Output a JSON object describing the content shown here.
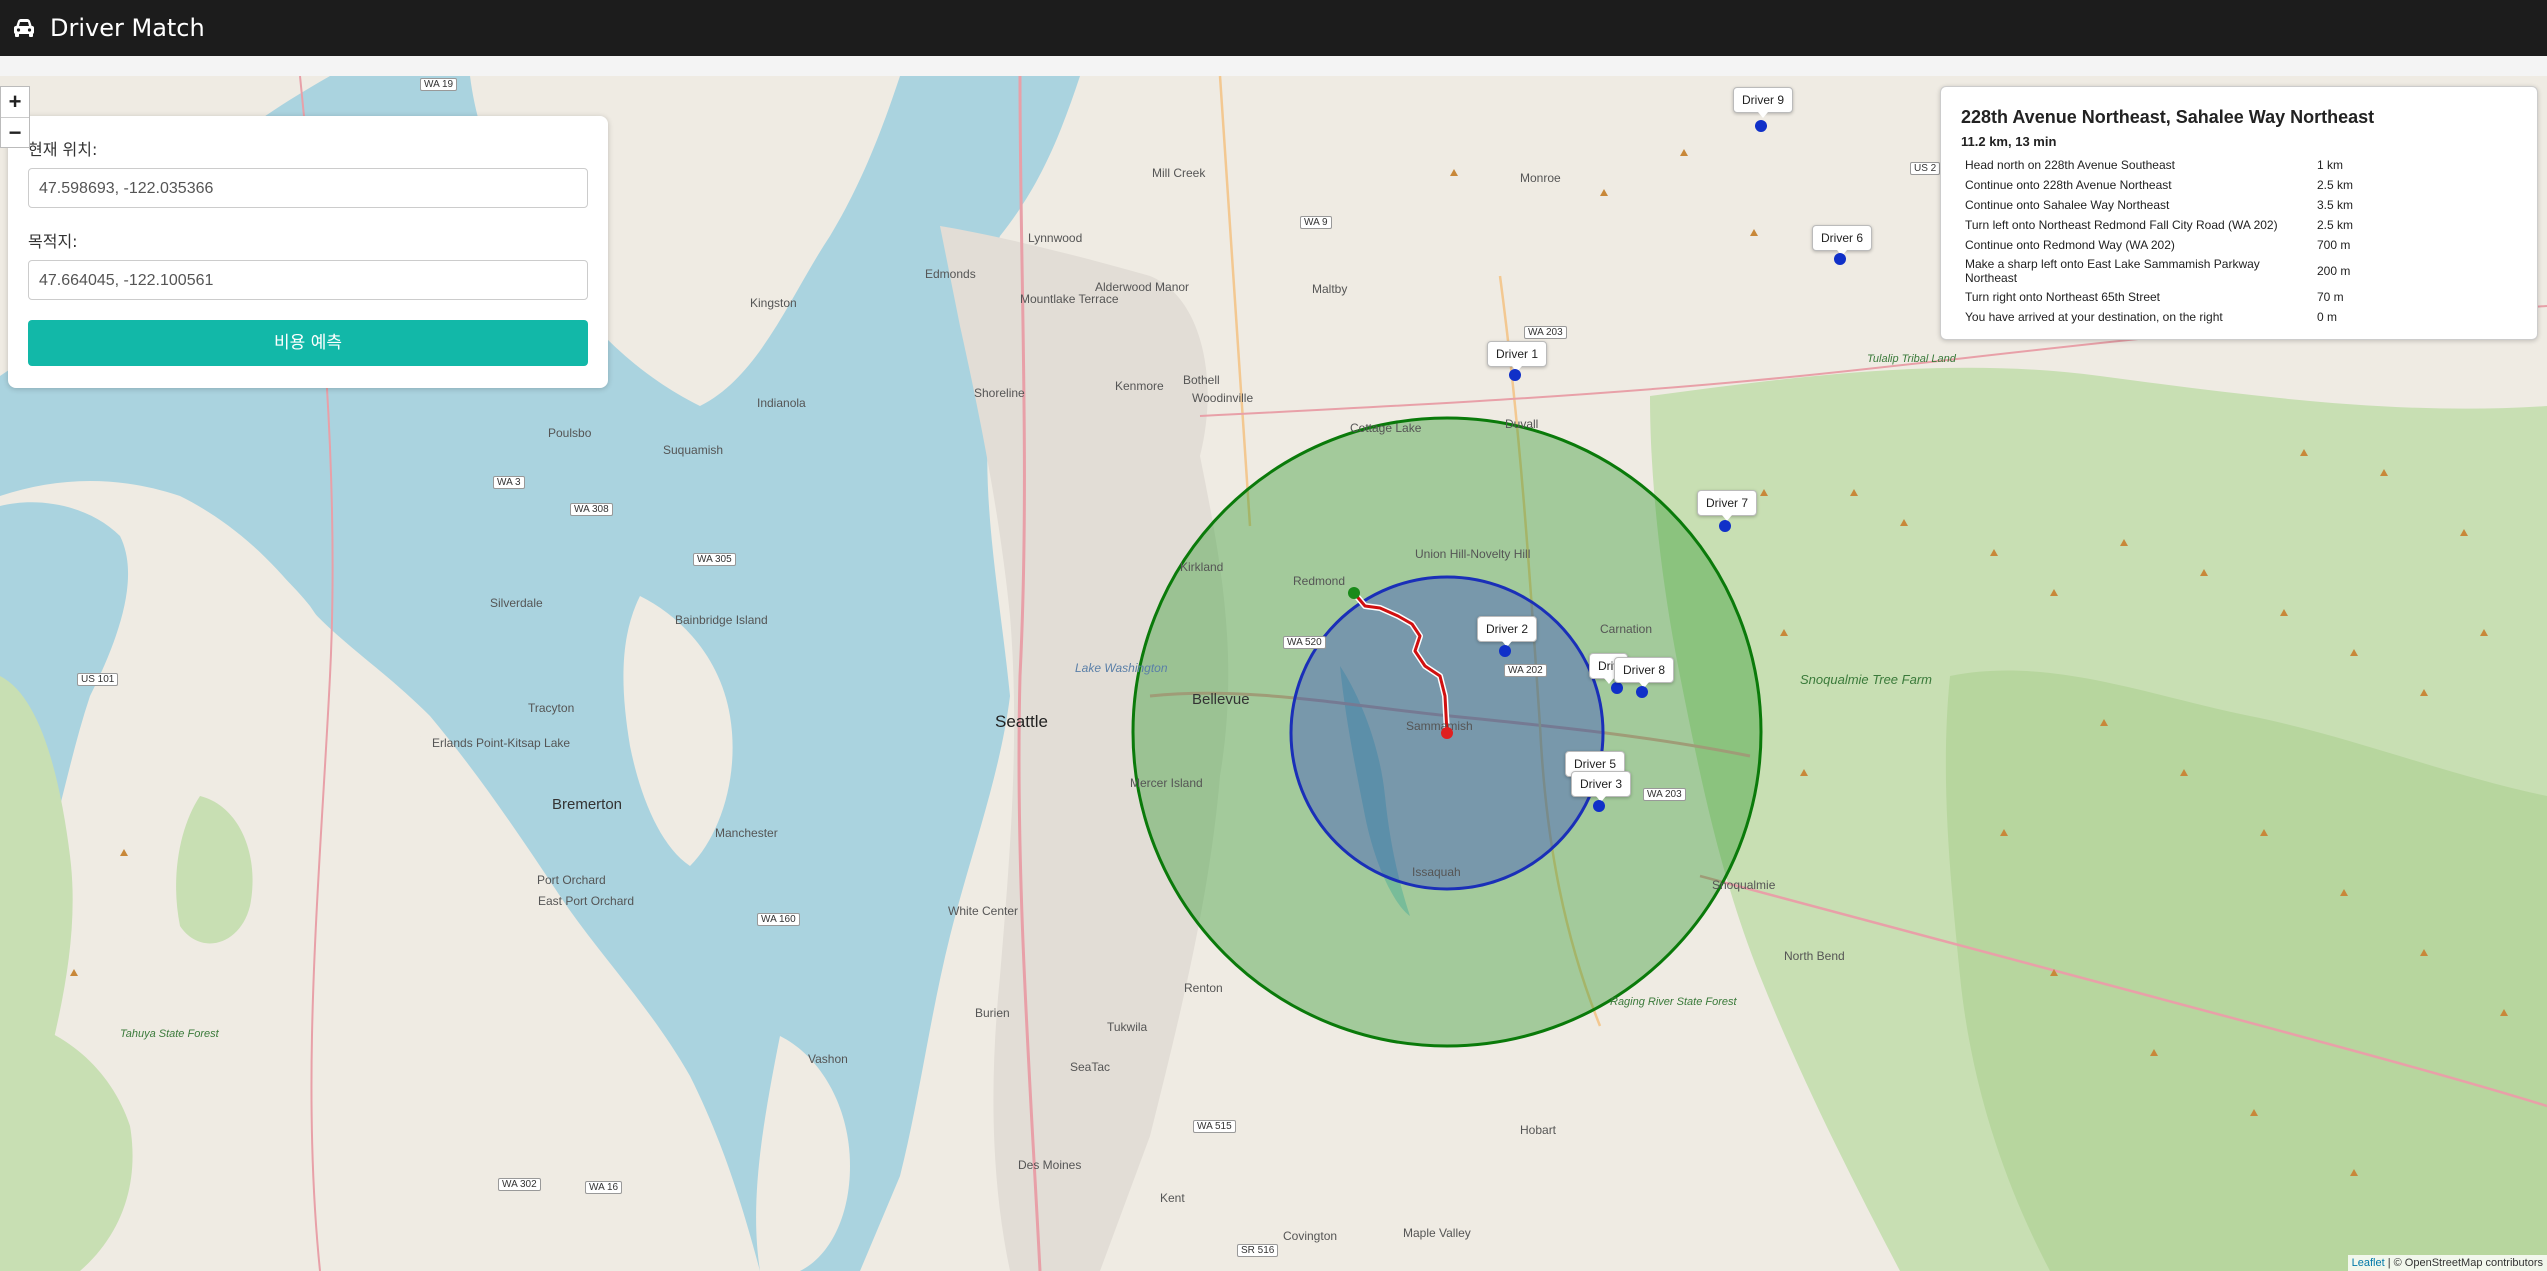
{
  "header": {
    "title": "Driver Match",
    "icon": "car-icon"
  },
  "zoom": {
    "in_label": "+",
    "out_label": "−"
  },
  "form": {
    "current_label": "현재 위치:",
    "current_value": "47.598693, -122.035366",
    "destination_label": "목적지:",
    "destination_value": "47.664045, -122.100561",
    "predict_button": "비용 예측"
  },
  "route": {
    "title": "228th Avenue Northeast, Sahalee Way Northeast",
    "summary": "11.2 km, 13 min",
    "steps": [
      {
        "instruction": "Head north on 228th Avenue Southeast",
        "distance": "1 km"
      },
      {
        "instruction": "Continue onto 228th Avenue Northeast",
        "distance": "2.5 km"
      },
      {
        "instruction": "Continue onto Sahalee Way Northeast",
        "distance": "3.5 km"
      },
      {
        "instruction": "Turn left onto Northeast Redmond Fall City Road (WA 202)",
        "distance": "2.5 km"
      },
      {
        "instruction": "Continue onto Redmond Way (WA 202)",
        "distance": "700 m"
      },
      {
        "instruction": "Make a sharp left onto East Lake Sammamish Parkway Northeast",
        "distance": "200 m"
      },
      {
        "instruction": "Turn right onto Northeast 65th Street",
        "distance": "70 m"
      },
      {
        "instruction": "You have arrived at your destination, on the right",
        "distance": "0 m"
      }
    ]
  },
  "drivers": [
    {
      "label": "Driver 9"
    },
    {
      "label": "Driver 6"
    },
    {
      "label": "Driver 1"
    },
    {
      "label": "Driver 7"
    },
    {
      "label": "Driver 2"
    },
    {
      "label": "Driver 4",
      "visible_text": "Driv"
    },
    {
      "label": "Driver 8"
    },
    {
      "label": "Driver 5"
    },
    {
      "label": "Driver 3"
    }
  ],
  "map_labels": {
    "seattle": "Seattle",
    "bellevue": "Bellevue",
    "redmond": "Redmond",
    "kirkland": "Kirkland",
    "sammamish": "Sammamish",
    "issaquah": "Issaquah",
    "bremerton": "Bremerton",
    "renton": "Renton",
    "kent": "Kent",
    "lynnwood": "Lynnwood",
    "edmonds": "Edmonds",
    "shoreline": "Shoreline",
    "bothell": "Bothell",
    "kenmore": "Kenmore",
    "woodinville": "Woodinville",
    "mill_creek": "Mill Creek",
    "monroe": "Monroe",
    "duvall": "Duvall",
    "carnation": "Carnation",
    "north_bend": "North Bend",
    "snoqualmie": "Snoqualmie",
    "mercer_island": "Mercer Island",
    "burien": "Burien",
    "tukwila": "Tukwila",
    "seatac": "SeaTac",
    "des_moines": "Des Moines",
    "vashon": "Vashon",
    "hobart": "Hobart",
    "maple_valley": "Maple Valley",
    "covington": "Covington",
    "white_center": "White Center",
    "kingston": "Kingston",
    "poulsbo": "Poulsbo",
    "silverdale": "Silverdale",
    "manchester": "Manchester",
    "port_orchard": "Port Orchard",
    "bainbridge": "Bainbridge Island",
    "lake_washington": "Lake Washington",
    "union_hill": "Union Hill-Novelty Hill",
    "cottage_lake": "Cottage Lake",
    "snoqualmie_tree_farm": "Snoqualmie Tree Farm",
    "tulalip": "Tulalip Tribal Land",
    "tahuya": "Tahuya State Forest",
    "raging_river": "Raging River State Forest",
    "maltby": "Maltby",
    "alderwood": "Alderwood Manor",
    "indianola": "Indianola",
    "suquamish": "Suquamish",
    "tracyton": "Tracyton",
    "erlands_point": "Erlands Point-Kitsap Lake",
    "east_port_orchard": "East Port Orchard",
    "mountlake_terrace": "Mountlake Terrace"
  },
  "highways": [
    "WA 19",
    "WA 9",
    "WA 203",
    "US 2",
    "WA 202",
    "WA 520",
    "WA 3",
    "WA 308",
    "WA 305",
    "US 101",
    "WA 160",
    "WA 515",
    "WA 302",
    "WA 16",
    "SR 516",
    "WA 203"
  ],
  "attribution": {
    "leaflet": "Leaflet",
    "rest": " | © OpenStreetMap contributors"
  },
  "colors": {
    "outer_circle": "#0a7a0a",
    "inner_circle": "#1a2fb8",
    "route": "#d01010",
    "driver_dot": "#1030c8",
    "origin": "#1a8a1a",
    "destination": "#e02020",
    "button": "#12b8a8"
  }
}
